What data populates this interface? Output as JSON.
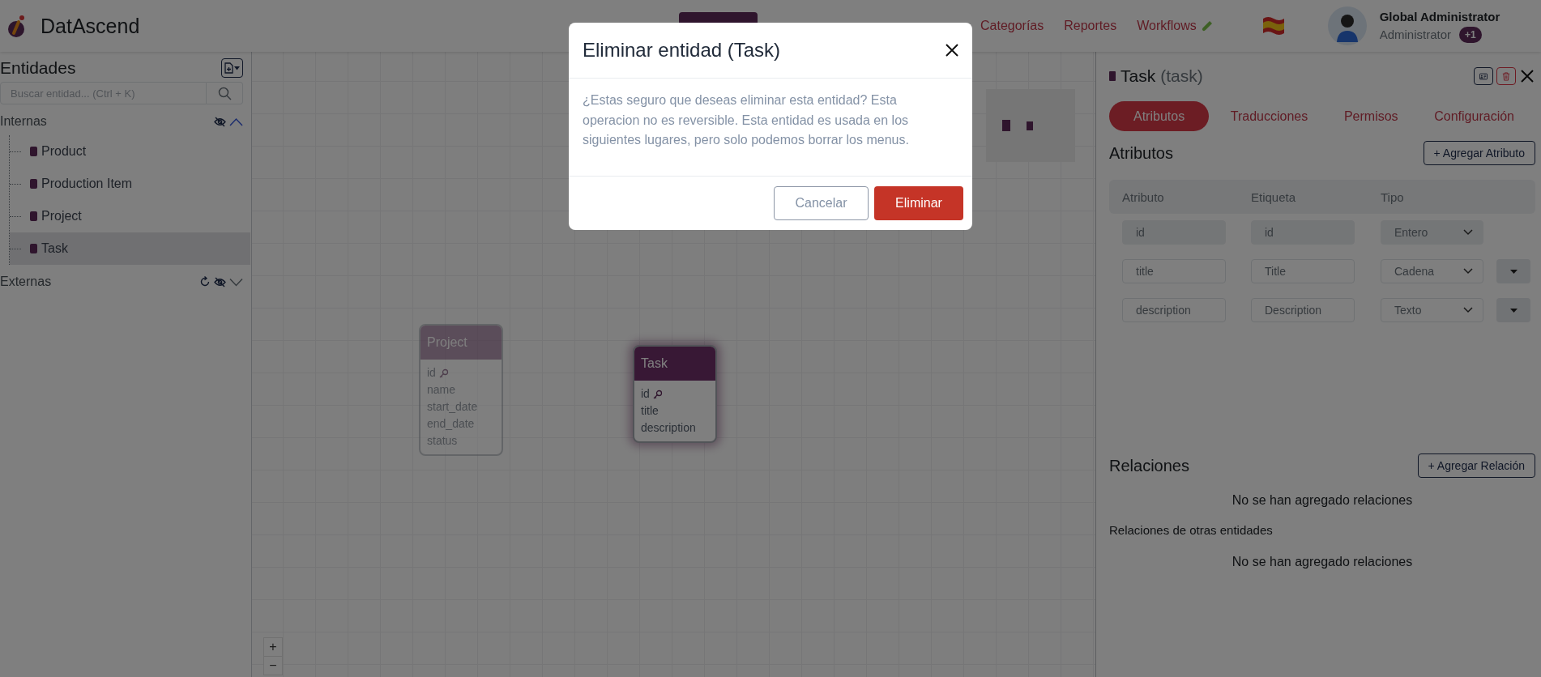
{
  "app": {
    "name": "DatAscend"
  },
  "nav": {
    "items": [
      {
        "selected": true
      },
      {
        "label": "Categorías",
        "selected": false
      },
      {
        "label": "Reportes",
        "selected": false
      },
      {
        "label": "Workflows",
        "selected": false
      }
    ]
  },
  "user": {
    "name": "Global Administrator",
    "role": "Administrator",
    "badge": "+1"
  },
  "sidebar": {
    "title": "Entidades",
    "search": {
      "placeholder": "Buscar entidad... (Ctrl + K)"
    },
    "groups": [
      {
        "label": "Internas",
        "kind": "internal",
        "expanded": true,
        "items": [
          {
            "label": "Product",
            "selected": false
          },
          {
            "label": "Production Item",
            "selected": false
          },
          {
            "label": "Project",
            "selected": false
          },
          {
            "label": "Task",
            "selected": true
          }
        ]
      },
      {
        "label": "Externas",
        "kind": "external",
        "expanded": false
      }
    ]
  },
  "canvas": {
    "nodes": [
      {
        "title": "Project",
        "selected": false,
        "fields": [
          {
            "name": "id",
            "kind": "key"
          },
          {
            "name": "name",
            "kind": "plain"
          },
          {
            "name": "start_date",
            "kind": "plain"
          },
          {
            "name": "end_date",
            "kind": "plain"
          },
          {
            "name": "status",
            "kind": "plain"
          }
        ]
      },
      {
        "title": "Task",
        "selected": true,
        "fields": [
          {
            "name": "id",
            "kind": "key"
          },
          {
            "name": "title",
            "kind": "plain"
          },
          {
            "name": "description",
            "kind": "plain"
          }
        ]
      }
    ],
    "zoom_controls": [
      "+",
      "−"
    ]
  },
  "panel": {
    "title": "Task",
    "subtitle": "(task)",
    "tabs": [
      {
        "label": "Atributos",
        "selected": true
      },
      {
        "label": "Traducciones",
        "selected": false
      },
      {
        "label": "Permisos",
        "selected": false
      },
      {
        "label": "Configuración",
        "selected": false
      }
    ],
    "attributes": {
      "heading": "Atributos",
      "add_button": "+ Agregar Atributo",
      "columns": [
        "Atributo",
        "Etiqueta",
        "Tipo"
      ],
      "rows": [
        {
          "name": "id",
          "label": "id",
          "type": "Entero",
          "disabled": true
        },
        {
          "name": "title",
          "label": "Title",
          "type": "Cadena",
          "disabled": false
        },
        {
          "name": "description",
          "label": "Description",
          "type": "Texto",
          "disabled": false
        }
      ]
    },
    "relations": {
      "heading": "Relaciones",
      "add_button": "+ Agregar Relación",
      "empty": "No se han agregado relaciones",
      "other_heading": "Relaciones de otras entidades",
      "other_empty": "No se han agregado relaciones"
    }
  },
  "dialog": {
    "title": "Eliminar entidad (Task)",
    "message": "¿Estas seguro que deseas eliminar esta entidad? Esta operacion no es reversible. Esta entidad es usada en los siguientes lugares, pero solo podemos borrar los menus.",
    "buttons": [
      {
        "label": "Cancelar",
        "kind": "secondary"
      },
      {
        "label": "Eliminar",
        "kind": "danger"
      }
    ]
  }
}
